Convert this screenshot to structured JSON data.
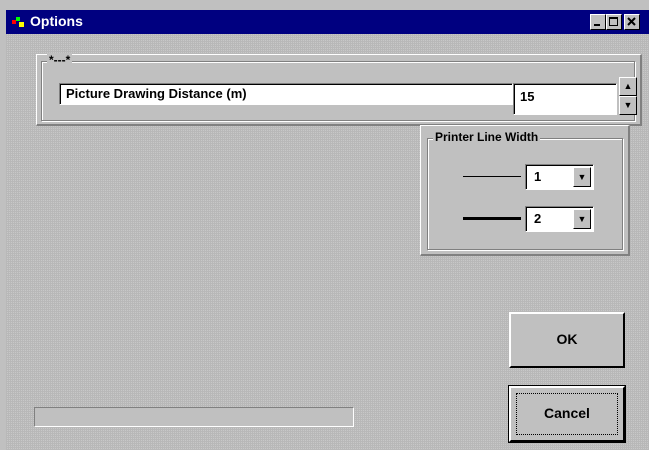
{
  "window": {
    "title": "Options",
    "app_icon": "app-icon"
  },
  "titlebar_buttons": [
    "minimize-icon",
    "maximize-icon",
    "close-icon"
  ],
  "group_distance": {
    "caption": "*---*",
    "label": "Picture Drawing Distance  (m)",
    "value": "15"
  },
  "group_printer": {
    "caption": "Printer Line Width",
    "thin": {
      "value": "1"
    },
    "thick": {
      "value": "2"
    }
  },
  "buttons": {
    "ok": "OK",
    "cancel": "Cancel"
  },
  "colors": {
    "titlebar": "#000080",
    "face": "#c0c0c0"
  }
}
